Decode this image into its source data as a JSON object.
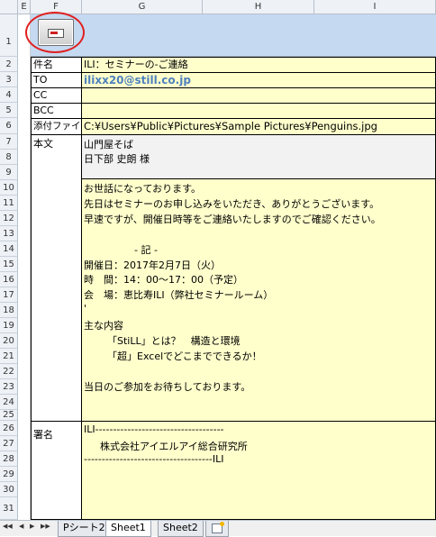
{
  "columns": [
    "E",
    "F",
    "G",
    "H",
    "I"
  ],
  "rows": [
    "1",
    "2",
    "3",
    "4",
    "5",
    "6",
    "7",
    "8",
    "9",
    "10",
    "11",
    "12",
    "13",
    "14",
    "15",
    "16",
    "17",
    "18",
    "19",
    "20",
    "21",
    "22",
    "23",
    "24",
    "25",
    "26",
    "27",
    "28",
    "29",
    "30",
    "31"
  ],
  "send_button_icon": "envelope-icon",
  "fields": {
    "subject_label": "件名",
    "subject_value": "ILI：セミナーの-ご連絡",
    "to_label": "TO",
    "to_value": "ilixx20@still.co.jp",
    "cc_label": "CC",
    "cc_value": "",
    "bcc_label": "BCC",
    "bcc_value": "",
    "attach_label": "添付ファイル",
    "attach_value": "C:¥Users¥Public¥Pictures¥Sample Pictures¥Penguins.jpg",
    "body_label": "本文",
    "signature_label": "署名"
  },
  "recipient_lines": [
    "山門屋そば",
    "日下部 史朗 様"
  ],
  "body_lines": [
    "お世話になっております。",
    "先日はセミナーのお申し込みをいただき、ありがとうございます。",
    "早速ですが、開催日時等をご連絡いたしますのでご確認ください。",
    "",
    "- 記 -",
    "開催日：2017年2月7日（火）",
    "時　間：14：00～17：00（予定）",
    "会　場：恵比寿ILI（弊社セミナールーム）",
    "'",
    "主な内容",
    "「StiLL」とは？　構造と環境",
    "「超」Excelでどこまでできるか！",
    "",
    "当日のご参加をお待ちしております。"
  ],
  "signature_lines": [
    "ILI------------------------------------",
    "株式会社アイエルアイ総合研究所",
    "------------------------------------ILI"
  ],
  "sheet_tabs": [
    "Pシート2",
    "Sheet1",
    "Sheet2"
  ],
  "active_tab": "Sheet1",
  "nav_arrows": [
    "◀◀",
    "◀",
    "▶",
    "▶▶"
  ],
  "colors": {
    "header_band": "#c5d9f1",
    "input_fill": "#ffffcc",
    "link_blue": "#4f81bd",
    "annotation_red": "#e02020"
  }
}
